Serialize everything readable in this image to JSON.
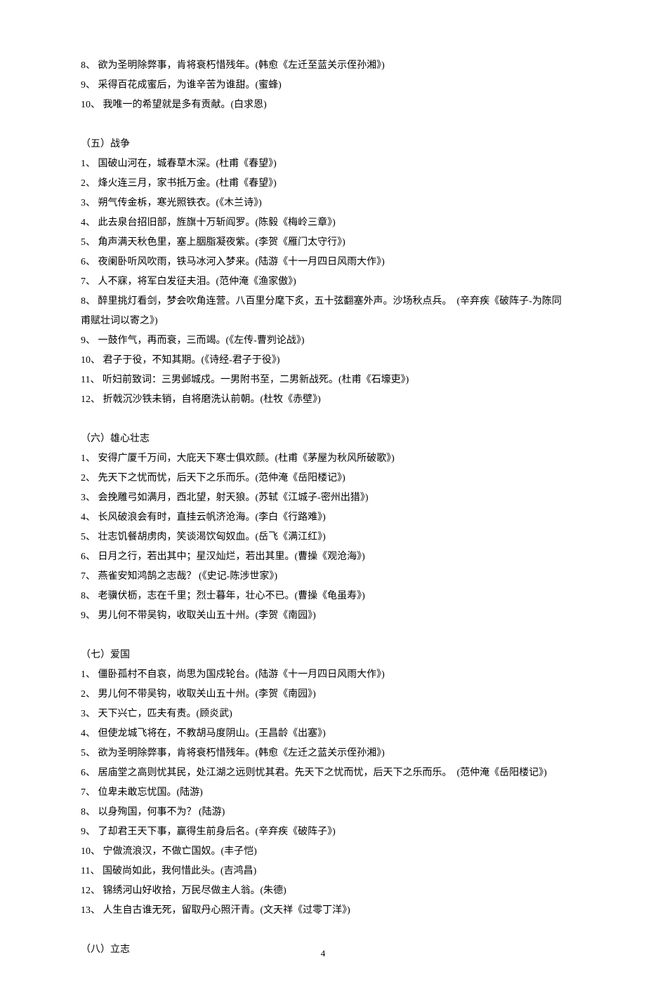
{
  "sections": [
    {
      "title": "",
      "startIndex": 8,
      "items": [
        "欲为圣明除弊事，肯将衰朽惜残年。(韩愈《左迁至蓝关示侄孙湘》)",
        "采得百花成蜜后，为谁辛苦为谁甜。(蜜蜂)",
        "我唯一的希望就是多有贡献。(白求恩)"
      ]
    },
    {
      "title": "（五）战争",
      "startIndex": 1,
      "items": [
        "国破山河在，城春草木深。(杜甫《春望》)",
        "烽火连三月，家书抵万金。(杜甫《春望》)",
        "朔气传金柝，寒光照铁衣。(《木兰诗》)",
        "此去泉台招旧部，旌旗十万斩阎罗。(陈毅《梅岭三章》)",
        "角声满天秋色里，塞上胭脂凝夜紫。(李贺《雁门太守行》)",
        "夜阑卧听风吹雨，铁马冰河入梦来。(陆游《十一月四日风雨大作》)",
        "人不寐，将军白发征夫泪。(范仲淹《渔家傲》)",
        "醉里挑灯看剑，梦会吹角连营。八百里分麾下炙，五十弦翻塞外声。沙场秋点兵。　(辛弃疾《破阵子-为陈同甫赋壮词以寄之》)",
        "一鼓作气，再而衰，三而竭。(《左传-曹刿论战》)",
        "君子于役，不知其期。(《诗经-君子于役》)",
        "听妇前致词：三男邺城戍。一男附书至，二男新战死。(杜甫《石壕吏》)",
        "折戟沉沙铁未销，自将磨洗认前朝。(杜牧《赤壁》)"
      ]
    },
    {
      "title": "（六）雄心壮志",
      "startIndex": 1,
      "items": [
        "安得广厦千万间，大庇天下寒士俱欢颜。(杜甫《茅屋为秋风所破歌》)",
        "先天下之忧而忧，后天下之乐而乐。(范仲淹《岳阳楼记》)",
        "会挽雕弓如满月，西北望，射天狼。(苏轼《江城子-密州出猎》)",
        "长风破浪会有时，直挂云帆济沧海。(李白《行路难》)",
        "壮志饥餐胡虏肉，笑谈渴饮匈奴血。(岳飞《满江红》)",
        "日月之行，若出其中；星汉灿烂，若出其里。(曹操《观沧海》)",
        "燕雀安知鸿鹄之志哉？ (《史记-陈涉世家》)",
        "老骥伏枥，志在千里；烈士暮年，壮心不已。(曹操《龟虽寿》)",
        "男儿何不带吴钩，收取关山五十州。(李贺《南园》)"
      ]
    },
    {
      "title": "（七）爱国",
      "startIndex": 1,
      "items": [
        "僵卧孤村不自哀，尚思为国戍轮台。(陆游《十一月四日风雨大作》)",
        "男儿何不带吴钩，收取关山五十州。(李贺《南园》)",
        "天下兴亡，匹夫有责。(顾炎武)",
        "但使龙城飞将在，不教胡马度阴山。(王昌龄《出塞》)",
        "欲为圣明除弊事，肯将衰朽惜残年。(韩愈《左迁之蓝关示侄孙湘》)",
        "居庙堂之高则忧其民，处江湖之远则忧其君。先天下之忧而忧，后天下之乐而乐。　(范仲淹《岳阳楼记》)",
        "位卑未敢忘忧国。(陆游)",
        "以身殉国，何事不为？ (陆游)",
        "了却君王天下事，赢得生前身后名。(辛弃疾《破阵子》)",
        "宁做流浪汉，不做亡国奴。(丰子恺)",
        "国破尚如此，我何惜此头。(吉鸿昌)",
        "锦绣河山好收拾，万民尽做主人翁。(朱德)",
        "人生自古谁无死，留取丹心照汗青。(文天祥《过零丁洋》)"
      ]
    },
    {
      "title": "（八）立志",
      "startIndex": 1,
      "items": []
    }
  ],
  "pageNumber": "4"
}
